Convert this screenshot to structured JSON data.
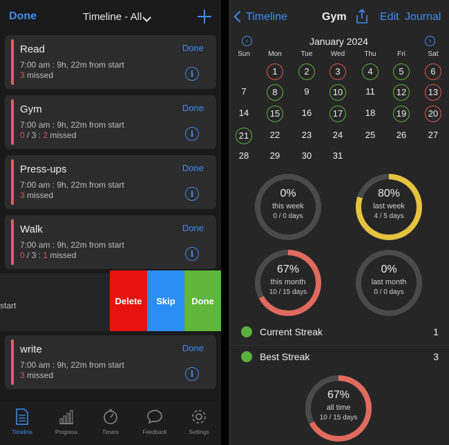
{
  "left": {
    "header": {
      "done_label": "Done",
      "title": "Timeline - All"
    },
    "cards": [
      {
        "title": "Read",
        "done": "Done",
        "time": "7:00 am : 9h, 22m from start",
        "missed_count": "3",
        "missed_label": " missed"
      },
      {
        "title": "Gym",
        "done": "Done",
        "time": "7:00 am : 9h, 22m from start",
        "done_count": "0",
        "sep1": " / 3 : ",
        "missed_count": "2",
        "missed_label": " missed"
      },
      {
        "title": "Press-ups",
        "done": "Done",
        "time": "7:00 am : 9h, 22m from start",
        "missed_count": "3",
        "missed_label": " missed"
      },
      {
        "title": "Walk",
        "done": "Done",
        "time": "7:00 am : 9h, 22m from start",
        "done_count": "0",
        "sep1": " / 3 : ",
        "missed_count": "1",
        "missed_label": " missed"
      },
      {
        "title": "write",
        "done": "Done",
        "time": "7:00 am : 9h, 22m from start",
        "missed_count": "3",
        "missed_label": " missed"
      }
    ],
    "swipe": {
      "partial_text": "start",
      "delete": "Delete",
      "skip": "Skip",
      "done": "Done"
    },
    "tabs": [
      "Timeline",
      "Progress",
      "Timers",
      "Feedback",
      "Settings"
    ]
  },
  "right": {
    "header": {
      "back_label": "Timeline",
      "title": "Gym",
      "edit": "Edit",
      "journal": "Journal"
    },
    "calendar": {
      "month": "January 2024",
      "weekdays": [
        "Sun",
        "Mon",
        "Tue",
        "Wed",
        "Thu",
        "Fri",
        "Sat"
      ],
      "days": [
        {
          "d": "1",
          "s": "r"
        },
        {
          "d": "2",
          "s": "g"
        },
        {
          "d": "3",
          "s": "r"
        },
        {
          "d": "4",
          "s": "g"
        },
        {
          "d": "5",
          "s": "g"
        },
        {
          "d": "6",
          "s": "r"
        },
        {
          "d": "7",
          "s": ""
        },
        {
          "d": "8",
          "s": "g"
        },
        {
          "d": "9",
          "s": ""
        },
        {
          "d": "10",
          "s": "g"
        },
        {
          "d": "11",
          "s": ""
        },
        {
          "d": "12",
          "s": "g"
        },
        {
          "d": "13",
          "s": "r"
        },
        {
          "d": "14",
          "s": ""
        },
        {
          "d": "15",
          "s": "g"
        },
        {
          "d": "16",
          "s": ""
        },
        {
          "d": "17",
          "s": "g"
        },
        {
          "d": "18",
          "s": ""
        },
        {
          "d": "19",
          "s": "g"
        },
        {
          "d": "20",
          "s": "r"
        },
        {
          "d": "21",
          "s": "g"
        },
        {
          "d": "22",
          "s": ""
        },
        {
          "d": "23",
          "s": ""
        },
        {
          "d": "24",
          "s": ""
        },
        {
          "d": "25",
          "s": ""
        },
        {
          "d": "26",
          "s": ""
        },
        {
          "d": "27",
          "s": ""
        },
        {
          "d": "28",
          "s": ""
        },
        {
          "d": "29",
          "s": ""
        },
        {
          "d": "30",
          "s": ""
        },
        {
          "d": "31",
          "s": ""
        }
      ]
    },
    "stats": [
      {
        "pct": "0%",
        "period": "this week",
        "count": "0 / 0 days",
        "fraction": 0,
        "color": "#4a4a4a"
      },
      {
        "pct": "80%",
        "period": "last week",
        "count": "4 / 5 days",
        "fraction": 0.8,
        "color": "#e5c33f"
      },
      {
        "pct": "67%",
        "period": "this month",
        "count": "10 / 15 days",
        "fraction": 0.67,
        "color": "#e06a5e"
      },
      {
        "pct": "0%",
        "period": "last month",
        "count": "0 / 0 days",
        "fraction": 0,
        "color": "#4a4a4a"
      }
    ],
    "streaks": [
      {
        "label": "Current Streak",
        "value": "1"
      },
      {
        "label": "Best Streak",
        "value": "3"
      }
    ],
    "all_time": {
      "pct": "67%",
      "period": "all time",
      "count": "10 / 15 days",
      "fraction": 0.67,
      "color": "#e06a5e"
    }
  }
}
